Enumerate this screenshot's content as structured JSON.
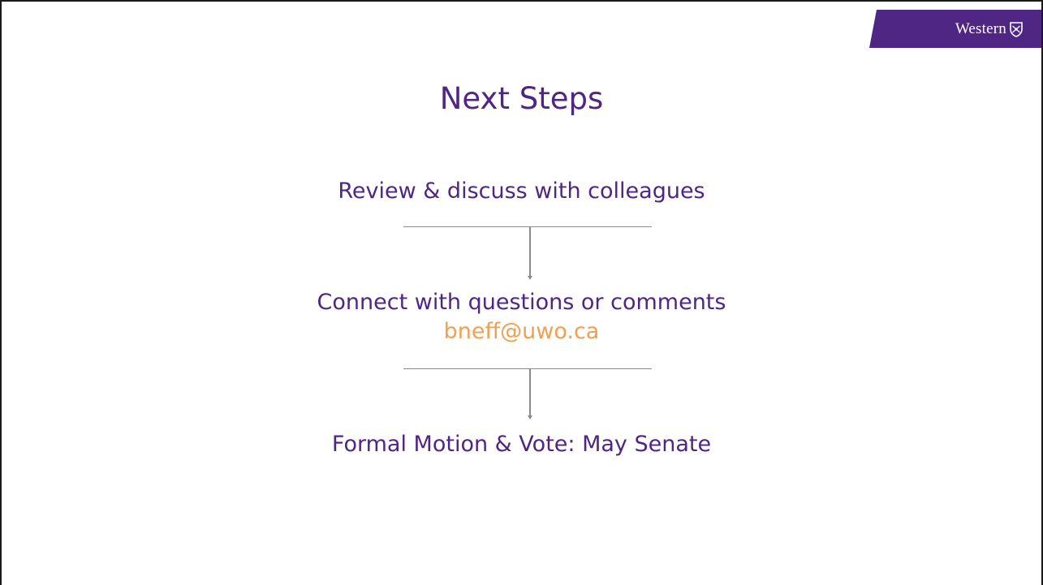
{
  "branding": {
    "wordmark": "Western",
    "icon": "crest-icon",
    "banner_color": "#4f2683"
  },
  "slide": {
    "title": "Next Steps",
    "steps": [
      {
        "label": "Review & discuss with colleagues"
      },
      {
        "label": "Connect with questions or comments",
        "email": "bneff@uwo.ca"
      },
      {
        "label": "Formal Motion & Vote: May Senate"
      }
    ]
  },
  "colors": {
    "primary_text": "#4f2683",
    "email_text": "#f0a050",
    "connector": "#8a8a8a"
  }
}
